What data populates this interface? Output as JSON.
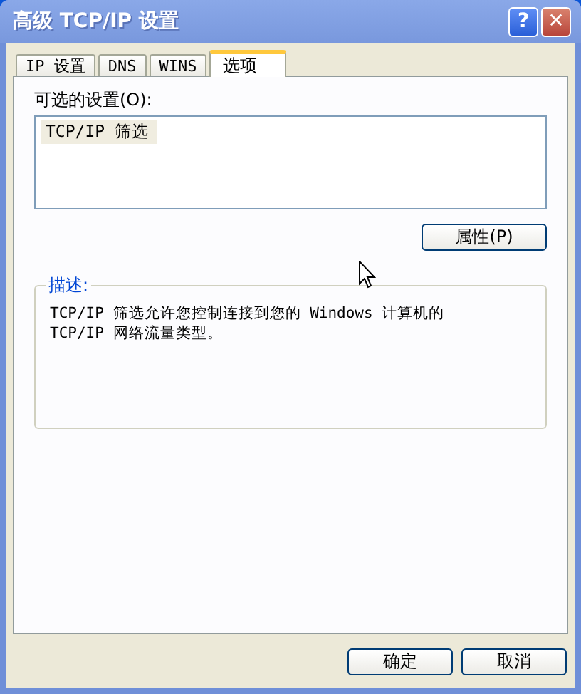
{
  "window": {
    "title": "高级 TCP/IP 设置",
    "title_buttons": [
      {
        "kind": "help",
        "label": "?"
      },
      {
        "kind": "close",
        "label": "✕"
      }
    ]
  },
  "tabs": [
    {
      "label": "IP 设置",
      "selected": false
    },
    {
      "label": "DNS",
      "selected": false
    },
    {
      "label": "WINS",
      "selected": false
    },
    {
      "label": "选项",
      "selected": true
    }
  ],
  "options": {
    "label": "可选的设置(O):",
    "items": [
      {
        "label": "TCP/IP 筛选",
        "selected": true
      }
    ],
    "properties_button": "属性(P)"
  },
  "description": {
    "title": "描述:",
    "lines": [
      "TCP/IP 筛选允许您控制连接到您的 Windows 计算机的",
      "TCP/IP 网络流量类型。"
    ]
  },
  "buttons": [
    "确定",
    "取消"
  ]
}
